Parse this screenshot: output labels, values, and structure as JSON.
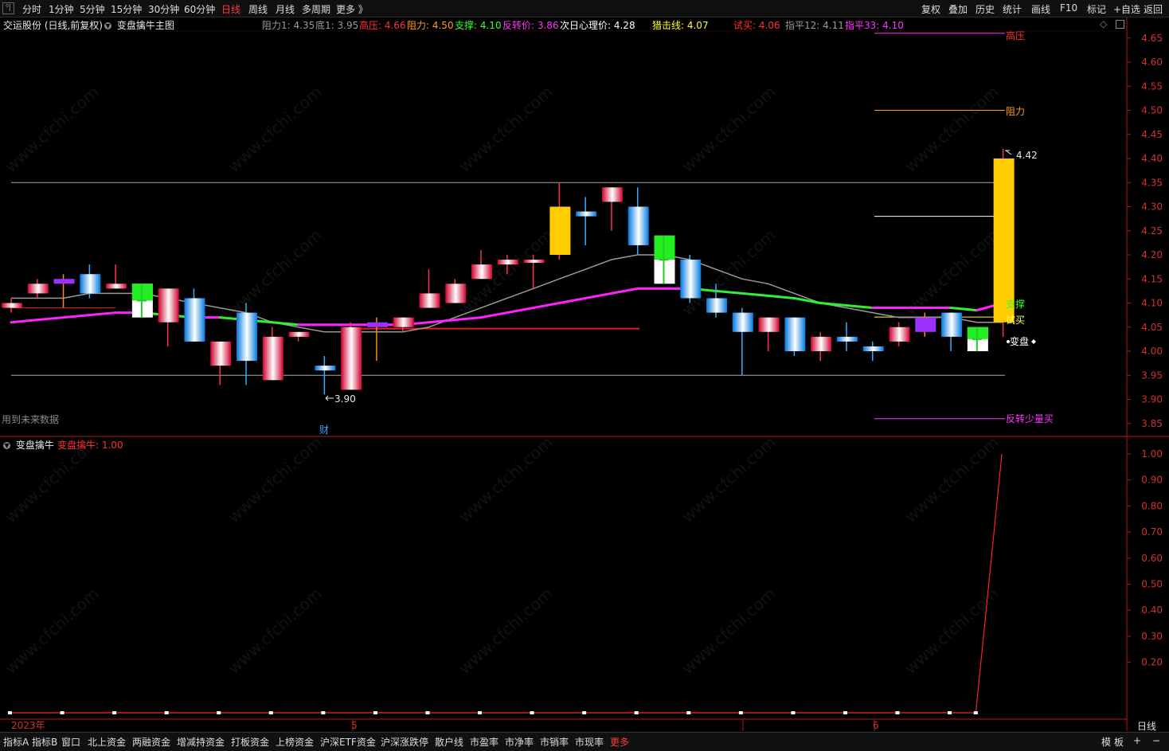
{
  "toolbar": {
    "left": [
      "分时",
      "1分钟",
      "5分钟",
      "15分钟",
      "30分钟",
      "60分钟",
      "日线",
      "周线",
      "月线",
      "多周期",
      "更多 》"
    ],
    "active_index": 6,
    "right": [
      "复权",
      "叠加",
      "历史",
      "统计",
      "画线",
      "F10",
      "标记",
      "+自选",
      "返回"
    ],
    "collapse_glyph": "⁰|"
  },
  "chart_header": {
    "stock": "交运股份 (日线,前复权)",
    "indicator": "变盘擒牛主图",
    "stats": [
      {
        "text": "阻力1: 4.35",
        "color": "#9a9a9a"
      },
      {
        "text": "底1: 3.95",
        "color": "#9a9a9a"
      },
      {
        "text": "高压: 4.66",
        "color": "#ff3030"
      },
      {
        "text": "阻力: 4.50",
        "color": "#ff9a1a"
      },
      {
        "text": "支撑: 4.10",
        "color": "#33ff33"
      },
      {
        "text": "反转价: 3.86",
        "color": "#ff33ff"
      },
      {
        "text": "次日心理价: 4.28",
        "color": "#ffffff"
      },
      {
        "text": "猎击线: 4.07",
        "color": "#ffff33"
      },
      {
        "text": "试买: 4.06",
        "color": "#ff3030"
      },
      {
        "text": "指平12: 4.11",
        "color": "#9a9a9a"
      },
      {
        "text": "指平33: 4.10",
        "color": "#ff33ff"
      }
    ],
    "diamond": "◇"
  },
  "main_axis": {
    "labels": [
      "4.65",
      "4.60",
      "4.55",
      "4.50",
      "4.45",
      "4.40",
      "4.35",
      "4.30",
      "4.25",
      "4.20",
      "4.15",
      "4.10",
      "4.05",
      "4.00",
      "3.95",
      "3.90",
      "3.85"
    ]
  },
  "annotations": {
    "future_data": "用到未来数据",
    "cai_marker": "财",
    "high_label": "4.42",
    "low_label": "3.90",
    "resistance_label": "阻力",
    "highpress_label": "高压",
    "support_label": "支撑",
    "trial_buy_label": "试买",
    "change_label": "变盘",
    "reverse_label": "反转少量买"
  },
  "indicator_header": {
    "name": "变盘擒牛",
    "value_text": "变盘擒牛: 1.00"
  },
  "indicator_axis": {
    "labels": [
      "1.00",
      "0.90",
      "0.80",
      "0.70",
      "0.60",
      "0.50",
      "0.40",
      "0.30",
      "0.20"
    ]
  },
  "date_axis": {
    "labels": [
      "2023年",
      "5",
      "6"
    ],
    "period": "日线"
  },
  "bottom_tabs": [
    "指标A",
    "指标B",
    "窗口",
    "北上资金",
    "两融资金",
    "增减持资金",
    "打板资金",
    "上榜资金",
    "沪深ETF资金",
    "沪深涨跌停",
    "散户线",
    "市盈率",
    "市净率",
    "市销率",
    "市现率",
    "更多"
  ],
  "bottom_right": [
    "模",
    "板",
    "+",
    "−"
  ],
  "watermark": "www.cfchi.com",
  "colors": {
    "up": "#ff2050",
    "down": "#19b8ff",
    "resistance": "#ff9a1a",
    "support": "#33ff33",
    "reverse": "#ff33ff",
    "trial": "#ffff33",
    "high": "#ff3030"
  },
  "chart_data": {
    "type": "candlestick",
    "candles": [
      {
        "o": 4.09,
        "c": 4.1,
        "h": 4.11,
        "l": 4.08,
        "style": "up"
      },
      {
        "o": 4.12,
        "c": 4.14,
        "h": 4.15,
        "l": 4.11,
        "style": "up"
      },
      {
        "o": 4.14,
        "c": 4.15,
        "h": 4.16,
        "l": 4.09,
        "style": "purple"
      },
      {
        "o": 4.16,
        "c": 4.12,
        "h": 4.18,
        "l": 4.11,
        "style": "down"
      },
      {
        "o": 4.13,
        "c": 4.14,
        "h": 4.18,
        "l": 4.13,
        "style": "up"
      },
      {
        "o": 4.07,
        "c": 4.14,
        "h": 4.14,
        "l": 4.07,
        "style": "greenwhite"
      },
      {
        "o": 4.06,
        "c": 4.13,
        "h": 4.13,
        "l": 4.01,
        "style": "up"
      },
      {
        "o": 4.11,
        "c": 4.02,
        "h": 4.13,
        "l": 4.02,
        "style": "down"
      },
      {
        "o": 3.97,
        "c": 4.02,
        "h": 4.02,
        "l": 3.93,
        "style": "up"
      },
      {
        "o": 4.08,
        "c": 3.98,
        "h": 4.1,
        "l": 3.93,
        "style": "down"
      },
      {
        "o": 3.94,
        "c": 4.03,
        "h": 4.05,
        "l": 3.94,
        "style": "up"
      },
      {
        "o": 4.03,
        "c": 4.04,
        "h": 4.04,
        "l": 4.02,
        "style": "up"
      },
      {
        "o": 3.97,
        "c": 3.96,
        "h": 3.99,
        "l": 3.91,
        "style": "down"
      },
      {
        "o": 3.92,
        "c": 4.05,
        "h": 4.06,
        "l": 3.92,
        "style": "up"
      },
      {
        "o": 4.06,
        "c": 4.05,
        "h": 4.07,
        "l": 3.98,
        "style": "purple"
      },
      {
        "o": 4.05,
        "c": 4.07,
        "h": 4.07,
        "l": 4.04,
        "style": "up"
      },
      {
        "o": 4.09,
        "c": 4.12,
        "h": 4.17,
        "l": 4.09,
        "style": "up"
      },
      {
        "o": 4.1,
        "c": 4.14,
        "h": 4.15,
        "l": 4.1,
        "style": "up"
      },
      {
        "o": 4.15,
        "c": 4.18,
        "h": 4.21,
        "l": 4.15,
        "style": "up"
      },
      {
        "o": 4.18,
        "c": 4.19,
        "h": 4.2,
        "l": 4.16,
        "style": "up"
      },
      {
        "o": 4.19,
        "c": 4.19,
        "h": 4.2,
        "l": 4.13,
        "style": "up"
      },
      {
        "o": 4.2,
        "c": 4.3,
        "h": 4.35,
        "l": 4.19,
        "style": "yellow"
      },
      {
        "o": 4.29,
        "c": 4.28,
        "h": 4.32,
        "l": 4.22,
        "style": "down"
      },
      {
        "o": 4.31,
        "c": 4.34,
        "h": 4.34,
        "l": 4.25,
        "style": "up"
      },
      {
        "o": 4.3,
        "c": 4.22,
        "h": 4.34,
        "l": 4.2,
        "style": "down"
      },
      {
        "o": 4.14,
        "c": 4.24,
        "h": 4.24,
        "l": 4.14,
        "style": "greenwhite"
      },
      {
        "o": 4.19,
        "c": 4.11,
        "h": 4.2,
        "l": 4.1,
        "style": "down"
      },
      {
        "o": 4.11,
        "c": 4.08,
        "h": 4.14,
        "l": 4.07,
        "style": "down"
      },
      {
        "o": 4.08,
        "c": 4.04,
        "h": 4.09,
        "l": 3.95,
        "style": "down"
      },
      {
        "o": 4.04,
        "c": 4.07,
        "h": 4.07,
        "l": 4.0,
        "style": "up"
      },
      {
        "o": 4.07,
        "c": 4.0,
        "h": 4.07,
        "l": 3.99,
        "style": "down"
      },
      {
        "o": 4.0,
        "c": 4.03,
        "h": 4.04,
        "l": 3.98,
        "style": "up"
      },
      {
        "o": 4.03,
        "c": 4.02,
        "h": 4.06,
        "l": 4.0,
        "style": "down"
      },
      {
        "o": 4.01,
        "c": 4.0,
        "h": 4.02,
        "l": 3.98,
        "style": "down"
      },
      {
        "o": 4.02,
        "c": 4.05,
        "h": 4.06,
        "l": 4.01,
        "style": "up"
      },
      {
        "o": 4.04,
        "c": 4.07,
        "h": 4.08,
        "l": 4.03,
        "style": "purple"
      },
      {
        "o": 4.08,
        "c": 4.03,
        "h": 4.08,
        "l": 4.0,
        "style": "down"
      },
      {
        "o": 4.0,
        "c": 4.05,
        "h": 4.05,
        "l": 4.0,
        "style": "greenwhite"
      },
      {
        "o": 4.06,
        "c": 4.4,
        "h": 4.42,
        "l": 4.03,
        "style": "yellow"
      }
    ],
    "ma_gray": [
      4.11,
      4.11,
      4.11,
      4.12,
      4.12,
      4.12,
      4.11,
      4.1,
      4.09,
      4.08,
      4.06,
      4.05,
      4.04,
      4.04,
      4.04,
      4.04,
      4.05,
      4.07,
      4.09,
      4.11,
      4.13,
      4.15,
      4.17,
      4.19,
      4.2,
      4.2,
      4.19,
      4.17,
      4.15,
      4.14,
      4.12,
      4.1,
      4.09,
      4.08,
      4.07,
      4.07,
      4.07,
      4.06,
      4.06
    ],
    "ma_main": [
      4.06,
      4.065,
      4.07,
      4.075,
      4.08,
      4.08,
      4.075,
      4.07,
      4.07,
      4.065,
      4.06,
      4.055,
      4.055,
      4.055,
      4.055,
      4.055,
      4.06,
      4.065,
      4.07,
      4.08,
      4.09,
      4.1,
      4.11,
      4.12,
      4.13,
      4.13,
      4.13,
      4.125,
      4.12,
      4.115,
      4.11,
      4.1,
      4.095,
      4.09,
      4.09,
      4.09,
      4.09,
      4.085,
      4.1
    ],
    "levels": {
      "high_line": 4.35,
      "low_line": 3.95,
      "highpress": 4.66,
      "resistance": 4.5,
      "nextday": 4.28,
      "hunt": 4.07,
      "reverse": 3.86
    },
    "indicator_values": [
      0,
      0,
      0,
      0,
      0,
      0,
      0,
      0,
      0,
      0,
      0,
      0,
      0,
      0,
      0,
      0,
      0,
      0,
      0,
      0,
      0,
      0,
      0,
      0,
      0,
      0,
      0,
      0,
      0,
      0,
      0,
      0,
      0,
      0,
      0,
      0,
      0,
      0,
      1.0
    ]
  }
}
